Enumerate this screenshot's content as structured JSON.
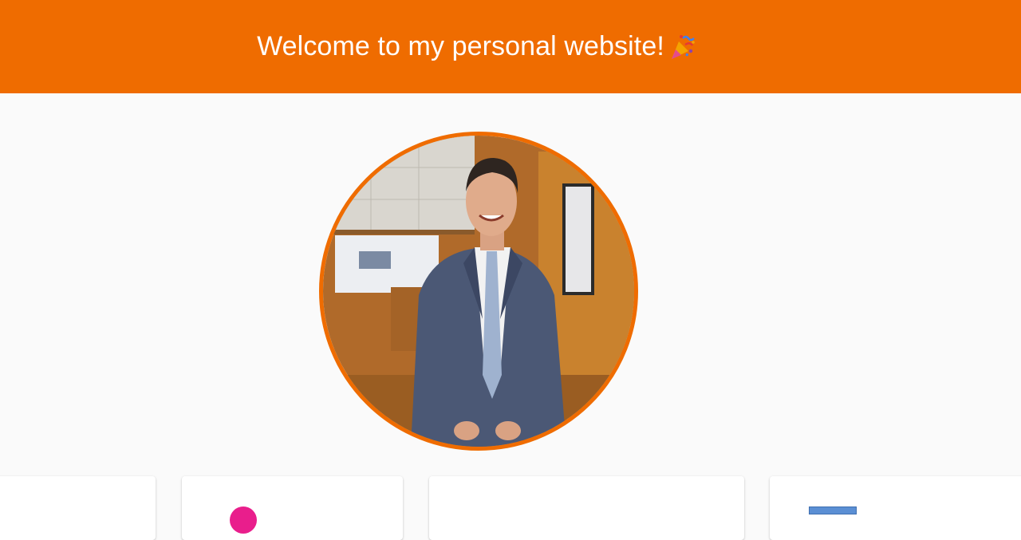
{
  "header": {
    "title": "Welcome to my personal website!",
    "emoji_icon": "party-popper-icon",
    "background_color": "#ef6c00"
  },
  "profile": {
    "photo_icon": "profile-photo",
    "border_color": "#ef6c00"
  },
  "cards": [
    {
      "icon": ""
    },
    {
      "icon": "pink-circle-icon"
    },
    {
      "icon": ""
    },
    {
      "icon": "laptop-icon"
    }
  ]
}
